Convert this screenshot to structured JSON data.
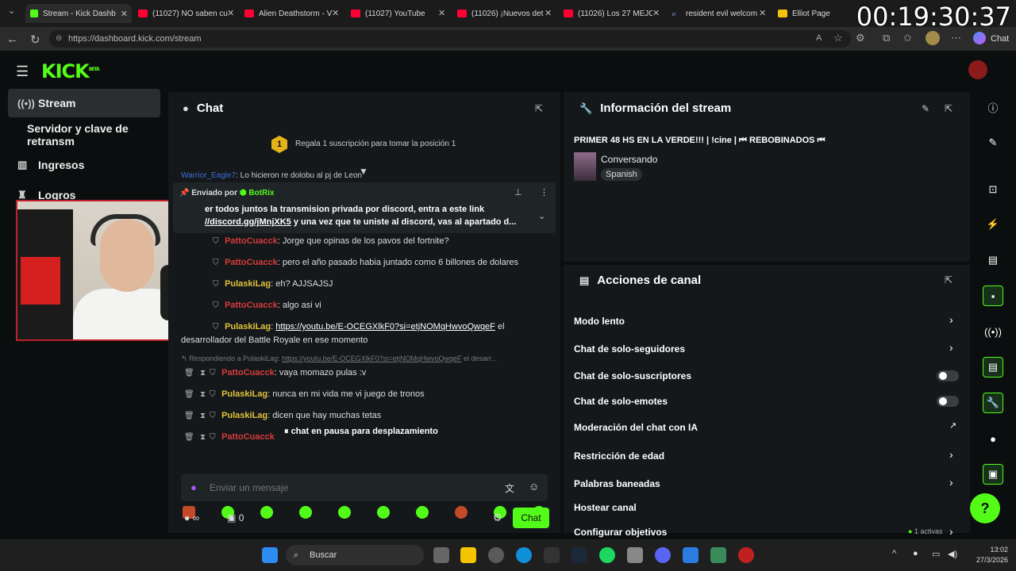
{
  "browser": {
    "tabs": [
      {
        "label": "Stream - Kick Dashb",
        "active": true
      },
      {
        "label": "(11027) NO saben cu"
      },
      {
        "label": "Alien Deathstorm - V"
      },
      {
        "label": "(11027) YouTube"
      },
      {
        "label": "(11026) ¡Nuevos det"
      },
      {
        "label": "(11026) Los 27 MEJO"
      },
      {
        "label": "resident evil welcom"
      },
      {
        "label": "Elliot Page"
      }
    ],
    "url": "https://dashboard.kick.com/stream",
    "chat_label": "Chat"
  },
  "overlay_timer": "00:19:30:37",
  "app": {
    "logo": "KICK",
    "logo_badge": "BETA",
    "sidebar": [
      {
        "label": "Stream",
        "icon": "broadcast-icon",
        "active": true
      },
      {
        "label": "Servidor y clave de retransm",
        "icon": ""
      },
      {
        "label": "Ingresos",
        "icon": "chart-icon"
      },
      {
        "label": "Logros",
        "icon": "trophy-icon"
      }
    ]
  },
  "chat": {
    "title": "Chat",
    "sub_goal_badge": "1",
    "sub_goal_text": "Regala 1 suscripción para tomar la posición 1",
    "partial_user": "Warrior_Eagle7",
    "partial_text": "Lo hicieron re dolobu al pj de Leon",
    "pinned_by": "Enviado por",
    "pinned_user": "BotRix",
    "pinned_line1": "er todos juntos la transmision privada por discord, entra a este link",
    "pinned_link": "//discord.gg/jMnjXK5",
    "pinned_line2": "y una vez que te uniste al discord, vas al apartado d...",
    "messages": [
      {
        "user": "PattoCuacck",
        "color": "red",
        "text": "Jorge que opinas de los pavos del fortnite?"
      },
      {
        "user": "PattoCuacck",
        "color": "red",
        "text": "pero el año pasado habia juntado como 6 billones de dolares"
      },
      {
        "user": "PulaskiLag",
        "color": "gold",
        "text": "eh? AJJSAJSJ"
      },
      {
        "user": "PattoCuacck",
        "color": "red",
        "text": "algo asi vi"
      },
      {
        "user": "PulaskiLag",
        "color": "gold",
        "text": "https://youtu.be/E-OCEGXlkF0?si=etjNOMqHwvoQwqeF",
        "text2": "el"
      }
    ],
    "wrap_text": "desarrollador del Battle Royale en ese momento",
    "reply_to": "Respondiendo a PulaskiLag:",
    "reply_link": "https://youtu.be/E-OCEGXlkF0?si=etjNOMqHwvoQwqeF",
    "reply_tail": "el desarr...",
    "messages2": [
      {
        "user": "PattoCuacck",
        "color": "red",
        "text": "vaya momazo pulas :v"
      },
      {
        "user": "PulaskiLag",
        "color": "gold",
        "text": "nunca en mi vida me vi juego de tronos"
      },
      {
        "user": "PulaskiLag",
        "color": "gold",
        "text": "dicen que hay muchas tetas"
      },
      {
        "user": "PattoCuacck",
        "color": "red",
        "text": ""
      }
    ],
    "paused": "chat en pausa para desplazamiento",
    "input_placeholder": "Enviar un mensaje",
    "viewers": "∞",
    "gifts": "0",
    "send_label": "Chat"
  },
  "stream_info": {
    "title": "Información del stream",
    "stream_title": "PRIMER 48 HS EN LA VERDE!!! | !cine | ⏮ REBOBINADOS ⏮",
    "category": "Conversando",
    "language": "Spanish"
  },
  "actions": {
    "title": "Acciones de canal",
    "items": [
      {
        "label": "Modo lento",
        "control": "chevron"
      },
      {
        "label": "Chat de solo-seguidores",
        "control": "chevron"
      },
      {
        "label": "Chat de solo-suscriptores",
        "control": "toggle"
      },
      {
        "label": "Chat de solo-emotes",
        "control": "toggle"
      },
      {
        "label": "Moderación del chat con IA",
        "control": "external"
      },
      {
        "label": "Restricción de edad",
        "control": "chevron"
      },
      {
        "label": "Palabras baneadas",
        "control": "chevron"
      },
      {
        "label": "Hostear canal",
        "control": "none"
      },
      {
        "label": "Configurar objetivos",
        "control": "chevron"
      }
    ],
    "goals_active": "1 activas"
  },
  "taskbar": {
    "search": "Buscar",
    "time": "13:02",
    "date": "27/3/2026"
  },
  "colors": {
    "brand": "#53fc18",
    "panel": "#14181b",
    "bg": "#0b0e0f"
  }
}
